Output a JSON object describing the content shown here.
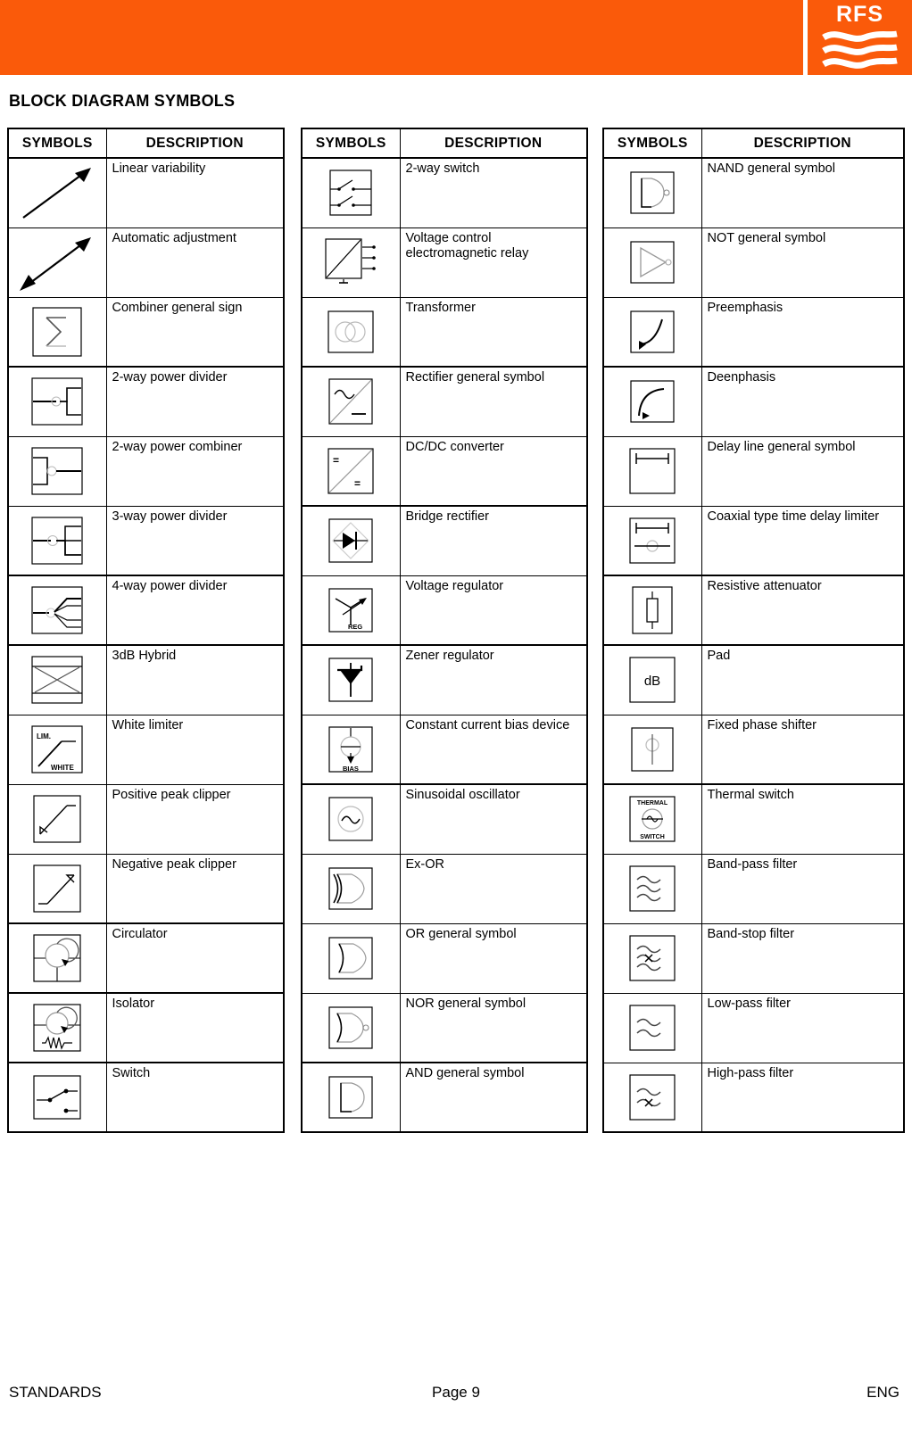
{
  "header": {
    "brand": "RFS",
    "band_color": "#fa5a0a",
    "logo_name": "rfs-logo"
  },
  "page_title": "BLOCK DIAGRAM SYMBOLS",
  "columns": [
    {
      "headers": {
        "symbols": "SYMBOLS",
        "description": "DESCRIPTION"
      },
      "rows": [
        {
          "icon": "linear-variability",
          "description": "Linear variability"
        },
        {
          "icon": "automatic-adjustment",
          "description": "Automatic adjustment"
        },
        {
          "icon": "combiner-general-sign",
          "description": "Combiner general sign"
        },
        {
          "icon": "2-way-power-divider",
          "description": "2-way power divider"
        },
        {
          "icon": "2-way-power-combiner",
          "description": "2-way power combiner"
        },
        {
          "icon": "3-way-power-divider",
          "description": "3-way power divider"
        },
        {
          "icon": "4-way-power-divider",
          "description": "4-way power divider"
        },
        {
          "icon": "3db-hybrid",
          "description": "3dB Hybrid"
        },
        {
          "icon": "white-limiter",
          "description": "White limiter",
          "labels": [
            "LIM.",
            "WHITE"
          ]
        },
        {
          "icon": "positive-peak-clipper",
          "description": "Positive peak clipper"
        },
        {
          "icon": "negative-peak-clipper",
          "description": "Negative peak clipper"
        },
        {
          "icon": "circulator",
          "description": "Circulator"
        },
        {
          "icon": "isolator",
          "description": "Isolator"
        },
        {
          "icon": "switch",
          "description": "Switch"
        }
      ]
    },
    {
      "headers": {
        "symbols": "SYMBOLS",
        "description": "DESCRIPTION"
      },
      "rows": [
        {
          "icon": "2-way-switch",
          "description": "2-way switch"
        },
        {
          "icon": "voltage-control-electromagnetic-relay",
          "description": "Voltage control electromagnetic relay"
        },
        {
          "icon": "transformer",
          "description": "Transformer"
        },
        {
          "icon": "rectifier-general-symbol",
          "description": "Rectifier general symbol"
        },
        {
          "icon": "dc-dc-converter",
          "description": "DC/DC converter",
          "labels": [
            "=",
            "="
          ]
        },
        {
          "icon": "bridge-rectifier",
          "description": "Bridge rectifier"
        },
        {
          "icon": "voltage-regulator",
          "description": "Voltage regulator",
          "labels": [
            "REG"
          ]
        },
        {
          "icon": "zener-regulator",
          "description": "Zener regulator"
        },
        {
          "icon": "constant-current-bias-device",
          "description": "Constant current bias device",
          "labels": [
            "BIAS"
          ]
        },
        {
          "icon": "sinusoidal-oscillator",
          "description": "Sinusoidal oscillator"
        },
        {
          "icon": "ex-or-gate",
          "description": "Ex-OR"
        },
        {
          "icon": "or-general-symbol",
          "description": "OR general symbol"
        },
        {
          "icon": "nor-general-symbol",
          "description": "NOR general symbol"
        },
        {
          "icon": "and-general-symbol",
          "description": "AND general symbol"
        }
      ]
    },
    {
      "headers": {
        "symbols": "SYMBOLS",
        "description": "DESCRIPTION"
      },
      "rows": [
        {
          "icon": "nand-general-symbol",
          "description": "NAND general symbol"
        },
        {
          "icon": "not-general-symbol",
          "description": "NOT general symbol"
        },
        {
          "icon": "preemphasis",
          "description": "Preemphasis"
        },
        {
          "icon": "deenphasis",
          "description": "Deenphasis"
        },
        {
          "icon": "delay-line-general-symbol",
          "description": "Delay line general symbol"
        },
        {
          "icon": "coaxial-type-time-delay-limiter",
          "description": "Coaxial type time delay limiter"
        },
        {
          "icon": "resistive-attenuator",
          "description": "Resistive attenuator"
        },
        {
          "icon": "pad",
          "description": "Pad",
          "labels": [
            "dB"
          ]
        },
        {
          "icon": "fixed-phase-shifter",
          "description": "Fixed phase shifter"
        },
        {
          "icon": "thermal-switch",
          "description": "Thermal switch",
          "labels": [
            "THERMAL",
            "SWITCH"
          ]
        },
        {
          "icon": "band-pass-filter",
          "description": "Band-pass filter"
        },
        {
          "icon": "band-stop-filter",
          "description": "Band-stop filter"
        },
        {
          "icon": "low-pass-filter",
          "description": "Low-pass filter"
        },
        {
          "icon": "high-pass-filter",
          "description": "High-pass filter"
        }
      ]
    }
  ],
  "footer": {
    "left": "STANDARDS",
    "center": "Page 9",
    "right": "ENG"
  }
}
